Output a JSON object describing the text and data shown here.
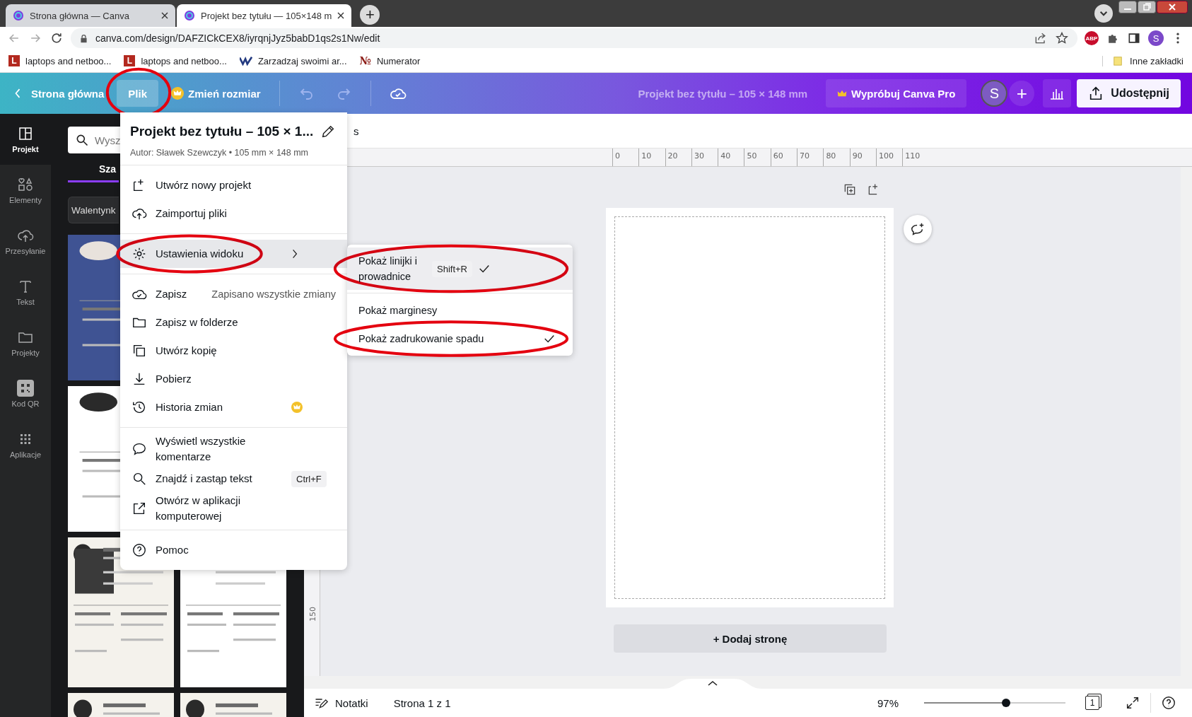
{
  "browser": {
    "tabs": [
      {
        "title": "Strona główna — Canva",
        "selected": false
      },
      {
        "title": "Projekt bez tytułu — 105×148 m",
        "selected": true
      }
    ],
    "new_tab_label": "+",
    "url": "canva.com/design/DAFZICkCEX8/iyrqnjJyz5babD1qs2s1Nw/edit",
    "extension_badge": "ABP",
    "profile_initial": "S",
    "bookmarks": [
      {
        "kind": "letter",
        "icon_text": "L",
        "label": "laptops and netboo..."
      },
      {
        "kind": "letter",
        "icon_text": "L",
        "label": "laptops and netboo..."
      },
      {
        "kind": "logo",
        "label": "Zarzadzaj swoimi ar..."
      },
      {
        "kind": "glyph",
        "icon_text": "№",
        "label": "Numerator"
      }
    ],
    "other_bookmarks": "Inne zakładki"
  },
  "header": {
    "back_label": "Strona główna",
    "menus": [
      {
        "label": "Plik",
        "selected": true,
        "circled": true,
        "pro": false
      },
      {
        "label": "Zmień rozmiar",
        "selected": false,
        "circled": false,
        "pro": true
      }
    ],
    "title": "Projekt bez tytułu – 105 × 148 mm",
    "pro_button": "Wypróbuj Canva Pro",
    "avatar": "S",
    "add_label": "+",
    "share_button": "Udostępnij"
  },
  "rail": [
    {
      "kind": "layout",
      "label": "Projekt",
      "selected": true
    },
    {
      "kind": "shapes",
      "label": "Elementy",
      "selected": false
    },
    {
      "kind": "upload",
      "label": "Przesyłanie",
      "selected": false
    },
    {
      "kind": "text",
      "label": "Tekst",
      "selected": false
    },
    {
      "kind": "folder",
      "label": "Projekty",
      "selected": false
    },
    {
      "kind": "qr",
      "label": "Kod QR",
      "selected": false
    },
    {
      "kind": "apps",
      "label": "Aplikacje",
      "selected": false
    }
  ],
  "panel": {
    "search_placeholder": "Wysz",
    "tab": "Sza",
    "chip": "Walentynk",
    "templates": [
      {
        "kind": "wide"
      },
      {
        "kind": "wide"
      },
      {
        "kind": "half"
      },
      {
        "kind": "half"
      },
      {
        "kind": "half"
      },
      {
        "kind": "half"
      }
    ]
  },
  "toolbar_text": "s",
  "file_menu": {
    "title": "Projekt bez tytułu – 105 × 1...",
    "subtitle": "Autor: Sławek Szewczyk • 105 mm × 148 mm",
    "groups": [
      [
        {
          "kind": "new",
          "label": "Utwórz nowy projekt",
          "selected": false,
          "circled": false
        },
        {
          "kind": "upload",
          "label": "Zaimportuj pliki",
          "selected": false,
          "circled": false
        }
      ],
      [
        {
          "kind": "gear",
          "label": "Ustawienia widoku",
          "submenu": true,
          "selected": true,
          "circled": true
        }
      ],
      [
        {
          "kind": "cloudcheck",
          "label": "Zapisz",
          "hint": "Zapisano wszystkie zmiany",
          "selected": false,
          "circled": false
        },
        {
          "kind": "folder",
          "label": "Zapisz w folderze",
          "selected": false,
          "circled": false
        },
        {
          "kind": "copy",
          "label": "Utwórz kopię",
          "selected": false,
          "circled": false
        },
        {
          "kind": "download",
          "label": "Pobierz",
          "selected": false,
          "circled": false
        },
        {
          "kind": "history",
          "label": "Historia zmian",
          "pro": true,
          "selected": false,
          "circled": false
        }
      ],
      [
        {
          "kind": "comment",
          "label": "Wyświetl wszystkie komentarze",
          "selected": false,
          "circled": false
        },
        {
          "kind": "search",
          "label": "Znajdź i zastąp tekst",
          "shortcut": "Ctrl+F",
          "selected": false,
          "circled": false
        },
        {
          "kind": "external",
          "label": "Otwórz w aplikacji komputerowej",
          "selected": false,
          "circled": false
        }
      ],
      [
        {
          "kind": "help",
          "label": "Pomoc",
          "selected": false,
          "circled": false
        }
      ]
    ]
  },
  "view_submenu": [
    [
      {
        "label": "Pokaż linijki i prowadnice",
        "shortcut": "Shift+R",
        "checked": true,
        "selected": true,
        "circled": true
      }
    ],
    [
      {
        "label": "Pokaż marginesy",
        "checked": false,
        "selected": false,
        "circled": false
      },
      {
        "label": "Pokaż zadrukowanie spadu",
        "checked": true,
        "selected": false,
        "circled": true
      }
    ]
  ],
  "canvas": {
    "ruler_ticks": [
      "0",
      "10",
      "20",
      "30",
      "40",
      "50",
      "60",
      "70",
      "80",
      "90",
      "100",
      "110"
    ],
    "vertical_tick": "150",
    "add_page": "+ Dodaj stronę"
  },
  "footer": {
    "notes": "Notatki",
    "page_info": "Strona 1 z 1",
    "zoom": "97%",
    "zoom_slider": {
      "level": 0.58
    },
    "page_count": "1"
  }
}
